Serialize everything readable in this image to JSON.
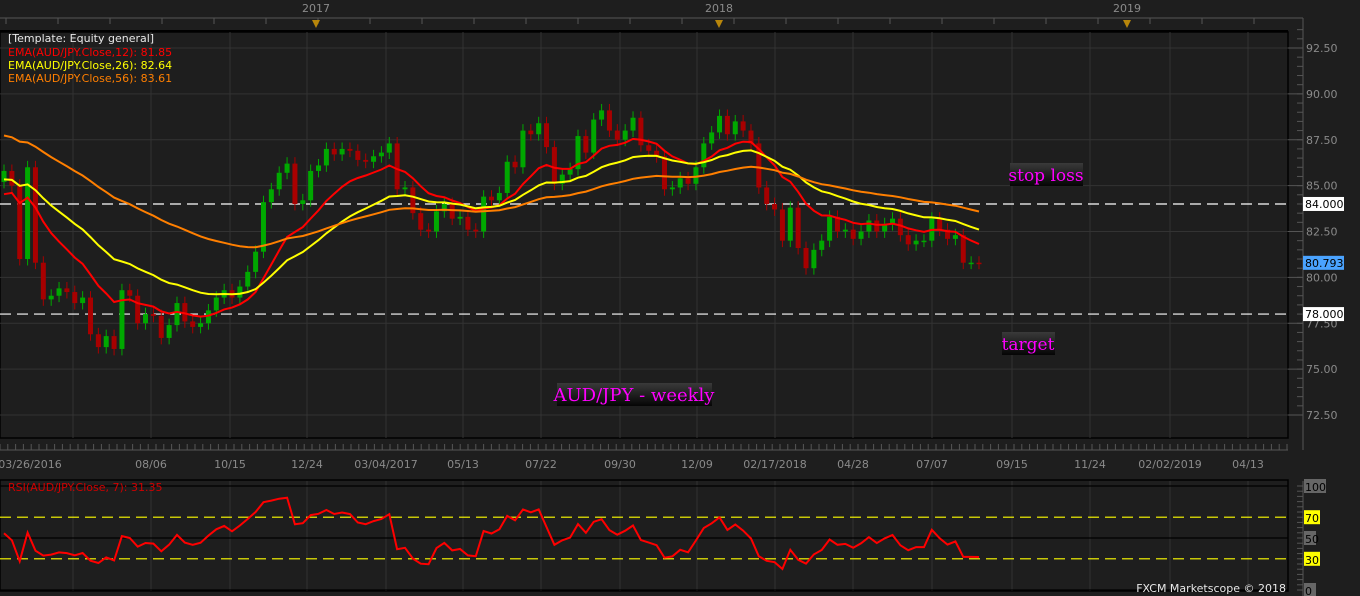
{
  "chart_data": {
    "type": "candlestick",
    "title": "AUD/JPY - weekly",
    "template_label": "[Template: Equity general]",
    "indicators": [
      {
        "label": "EMA(AUD/JPY.Close,12): 81.85",
        "period": 12,
        "value": 81.85,
        "color": "#ff0000",
        "seed": 84.3
      },
      {
        "label": "EMA(AUD/JPY.Close,26): 82.64",
        "period": 26,
        "value": 82.64,
        "color": "#ffff00",
        "seed": 85.3
      },
      {
        "label": "EMA(AUD/JPY.Close,56): 83.61",
        "period": 56,
        "value": 83.61,
        "color": "#ff7f00",
        "seed": 87.8
      }
    ],
    "first_open": 85.2,
    "closes": [
      85.8,
      85.0,
      81.0,
      86.0,
      80.8,
      78.8,
      79.0,
      79.4,
      79.2,
      78.6,
      78.9,
      76.9,
      76.2,
      76.8,
      76.1,
      79.3,
      79.0,
      77.5,
      78.0,
      77.9,
      76.7,
      77.4,
      78.6,
      77.6,
      77.3,
      77.5,
      78.2,
      78.9,
      79.3,
      78.9,
      79.5,
      80.3,
      81.4,
      84.1,
      84.8,
      85.7,
      86.2,
      84.0,
      84.2,
      85.8,
      86.1,
      87.0,
      86.7,
      87.0,
      86.9,
      86.4,
      86.3,
      86.6,
      86.8,
      87.3,
      84.8,
      84.9,
      83.5,
      82.6,
      82.5,
      83.6,
      84.0,
      83.2,
      83.3,
      82.6,
      82.5,
      84.4,
      84.2,
      84.6,
      86.3,
      86.0,
      88.0,
      87.8,
      88.4,
      87.1,
      85.1,
      85.6,
      85.9,
      87.7,
      86.8,
      88.6,
      89.1,
      88.0,
      87.5,
      88.0,
      88.7,
      87.2,
      86.9,
      86.6,
      84.8,
      84.9,
      85.4,
      85.1,
      86.0,
      87.3,
      87.9,
      88.8,
      87.8,
      88.5,
      88.0,
      87.3,
      84.9,
      84.0,
      83.7,
      82.0,
      83.8,
      81.6,
      80.5,
      81.5,
      82.0,
      83.3,
      82.5,
      82.6,
      82.1,
      82.5,
      83.1,
      82.5,
      82.9,
      83.2,
      82.3,
      81.8,
      82.0,
      82.0,
      83.2,
      82.6,
      82.1,
      82.3,
      80.8,
      80.8,
      80.79
    ],
    "y_ticks": [
      "92.50",
      "90.00",
      "87.50",
      "85.00",
      "82.50",
      "80.00",
      "77.50",
      "75.00",
      "72.50"
    ],
    "y_tick_values": [
      92.5,
      90,
      87.5,
      85,
      82.5,
      80,
      77.5,
      75,
      72.5
    ],
    "ylim": [
      71,
      93.7
    ],
    "x_ticks": [
      "03/26/2016",
      "08/06",
      "10/15",
      "12/24",
      "03/04/2017",
      "05/13",
      "07/22",
      "09/30",
      "12/09",
      "02/17/2018",
      "04/28",
      "07/07",
      "09/15",
      "11/24",
      "02/02/2019",
      "04/13"
    ],
    "year_markers": [
      "2017",
      "2018",
      "2019"
    ],
    "horizontal_lines": [
      {
        "value": 84.0,
        "label": "84.000",
        "annotation": "stop loss"
      },
      {
        "value": 78.0,
        "label": "78.000",
        "annotation": "target"
      }
    ],
    "last_price": {
      "value": 80.793,
      "label": "80.793",
      "color": "#4aa3ff"
    },
    "rsi": {
      "label": "RSI(AUD/JPY.Close, 7): 31.35",
      "period": 7,
      "value": 31.35,
      "color": "#ff0000",
      "levels": [
        {
          "value": 100,
          "label": "100"
        },
        {
          "value": 70,
          "label": "70"
        },
        {
          "value": 50,
          "label": "50"
        },
        {
          "value": 30,
          "label": "30"
        },
        {
          "value": 0,
          "label": "0"
        }
      ]
    },
    "colors": {
      "up": "#00a800",
      "down": "#a80000",
      "background": "#1e1e1e",
      "grid": "#333333",
      "level_line": "#ffff00",
      "annotation_text": "#ff00ff"
    }
  },
  "footer": {
    "credit": "FXCM Marketscope © 2018"
  }
}
